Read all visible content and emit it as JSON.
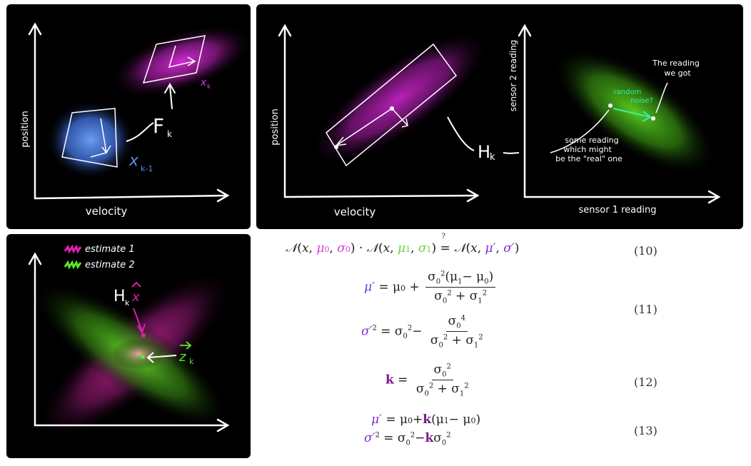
{
  "panel1": {
    "x_axis_label": "velocity",
    "y_axis_label": "position",
    "label_prev_state": "x",
    "label_prev_sub": "k-1",
    "label_transition": "F",
    "label_transition_sub": "k",
    "label_state": "x",
    "label_state_sub": "k",
    "colors": {
      "prev_blob": "#4a7fe0",
      "state_blob": "#c21fc2"
    }
  },
  "panel2": {
    "left_x_axis_label": "velocity",
    "left_y_axis_label": "position",
    "transform_label": "H",
    "transform_sub": "k",
    "right_x_axis_label": "sensor 1 reading",
    "right_y_axis_label": "sensor 2 reading",
    "annotation_reading_got": [
      "The reading",
      "we got"
    ],
    "annotation_noise": [
      "random",
      "noise?"
    ],
    "annotation_real": [
      "some reading",
      "which might",
      "be the \"real\" one"
    ],
    "colors": {
      "state_blob": "#b020b0",
      "sensor_blob": "#3fae1a",
      "noise_arrow": "#3af0a0"
    }
  },
  "panel3": {
    "legend": [
      {
        "label": "estimate 1",
        "color": "#e01fb0"
      },
      {
        "label": "estimate 2",
        "color": "#5ae82a"
      }
    ],
    "label_h": "H",
    "label_h_sub": "k",
    "label_xhat": "x",
    "label_z": "z",
    "label_z_sub": "k"
  },
  "equations": {
    "eq10_number": "(10)",
    "eq11_number": "(11)",
    "eq12_number": "(12)",
    "eq13_number": "(13)"
  }
}
